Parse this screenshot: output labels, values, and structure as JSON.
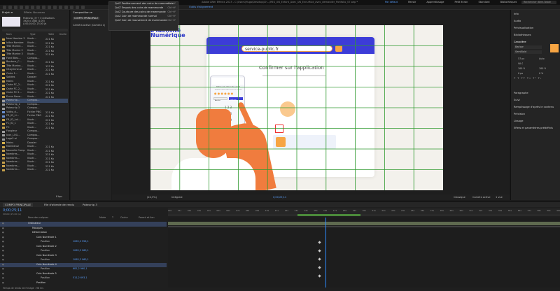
{
  "app": {
    "title": "Adobe After Effects 2023 - C:\\Users\\Hugo\\Desktop\\Ch...\\RES_UN_Enfant_Avec_UN_Ennuffuid_avec_demander_Portfolio_07.aep *",
    "workspaces": [
      "Par défaut",
      "Revoir",
      "Apprentissage",
      "Petit écran",
      "Standard",
      "Bibliothèques"
    ],
    "search_placeholder": "Rechercher: Bem-Totale"
  },
  "colors": {
    "accent_blue": "#2d8cff",
    "highlight_orange": "#f7a543",
    "grid_green": "#2f9a2f",
    "canvas_bg": "#f3f1ec",
    "ui_bg": "#1b1b1b"
  },
  "project_panel": {
    "tab": "Projet ≡",
    "tab2": "Effets: Nouveau",
    "preview_info": [
      "Pokeunip_3++  0 utilisations",
      "1920 x 1080  (1,00)",
      "Δ 00;10;00, 25,00 i/s"
    ],
    "columns": [
      "Nom",
      "Type",
      "Taille",
      "Durée"
    ],
    "items": [
      {
        "name": "Nom Nombre 3",
        "type": "Illustr...",
        "size": "221 Ko",
        "color": "#c6a04b"
      },
      {
        "name": "Icône Nombre",
        "type": "Illustr...",
        "size": "221 Ko",
        "color": "#c6a04b"
      },
      {
        "name": "Tête Marine...",
        "type": "Illustr...",
        "size": "221 Ko",
        "color": "#c6a04b"
      },
      {
        "name": "Tête Marine 2",
        "type": "Illustr...",
        "size": "221 Ko",
        "color": "#c6a04b"
      },
      {
        "name": "Tête Marine 3",
        "type": "Illustr...",
        "size": "221 Ko",
        "color": "#c6a04b"
      },
      {
        "name": "Fond Bleu...",
        "type": "Compos...",
        "size": "",
        "color": "#9c9c9c"
      },
      {
        "name": "Boutons_C...",
        "type": "Illustr...",
        "size": "221 Ko",
        "color": "#c6a04b"
      },
      {
        "name": "Tête Marine...",
        "type": "Illustr...",
        "size": "137 Ko",
        "color": "#c6a04b"
      },
      {
        "name": "Citoyenne.ai",
        "type": "Illustr...",
        "size": "221 Ko",
        "color": "#c6a04b"
      },
      {
        "name": "Carte 1...",
        "type": "Illustr...",
        "size": "221 Ko",
        "color": "#c6a04b"
      },
      {
        "name": "Solides",
        "type": "Dossier",
        "size": "",
        "color": "#d4b04a"
      },
      {
        "name": "Mains",
        "type": "Illustr...",
        "size": "221 Ko",
        "color": "#c6a04b"
      },
      {
        "name": "Carte FC_2...",
        "type": "Illustr...",
        "size": "221 Ko",
        "color": "#c6a04b"
      },
      {
        "name": "Carte FC_2...",
        "type": "Illustr...",
        "size": "221 Ko",
        "color": "#c6a04b"
      },
      {
        "name": "Carte FC 2...",
        "type": "Illustr...",
        "size": "221 Ko",
        "color": "#c6a04b"
      },
      {
        "name": "Ecran Nave...",
        "type": "Illustr...",
        "size": "221 Ko",
        "color": "#c6a04b"
      },
      {
        "name": "Pokeunip...",
        "type": "Compos...",
        "size": "",
        "color": "#9c9c9c"
      },
      {
        "name": "Pokeunip_2",
        "type": "Compos...",
        "size": "",
        "color": "#9c9c9c"
      },
      {
        "name": "Pokeunip 3",
        "type": "Compos...",
        "size": "",
        "color": "#9c9c9c"
      },
      {
        "name": "Vidéo_d...",
        "type": "Fichier PNG",
        "size": "221 Ko",
        "color": "#6a8fd0"
      },
      {
        "name": "FR_ID_Li...",
        "type": "Fichier PNG",
        "size": "221 Ko",
        "color": "#6a8fd0"
      },
      {
        "name": "FR_ID_LoL...",
        "type": "Illustr...",
        "size": "221 Ko",
        "color": "#c6a04b"
      },
      {
        "name": "FC_ID_1",
        "type": "Illustr...",
        "size": "221 Ko",
        "color": "#c6a04b"
      },
      {
        "name": "FC",
        "type": "Illustr...",
        "size": "221 Ko",
        "color": "#c6a04b"
      },
      {
        "name": "Fongleur",
        "type": "Compos...",
        "size": "",
        "color": "#9c9c9c"
      },
      {
        "name": "Icon_LOG...",
        "type": "Compos...",
        "size": "",
        "color": "#9c9c9c"
      },
      {
        "name": "Logo2.ai",
        "type": "Compos...",
        "size": "",
        "color": "#9c9c9c"
      },
      {
        "name": "Mains",
        "type": "Dossier",
        "size": "",
        "color": "#d4b04a"
      },
      {
        "name": "Mainbleu2",
        "type": "Illustr...",
        "size": "221 Ko",
        "color": "#c6a04b"
      },
      {
        "name": "Nouvelle Comp",
        "type": "Illustr...",
        "size": "221 Ko",
        "color": "#c6a04b"
      },
      {
        "name": "Nombres...",
        "type": "Illustr...",
        "size": "221 Ko",
        "color": "#c6a04b"
      },
      {
        "name": "Nombres...",
        "type": "Illustr...",
        "size": "221 Ko",
        "color": "#c6a04b"
      },
      {
        "name": "Nombres...",
        "type": "Illustr...",
        "size": "221 Ko",
        "color": "#c6a04b"
      },
      {
        "name": "Nombres...",
        "type": "Illustr...",
        "size": "221 Ko",
        "color": "#c6a04b"
      },
      {
        "name": "Nombres...",
        "type": "Illustr...",
        "size": "221 Ko",
        "color": "#c6a04b"
      }
    ],
    "footer": "8 bpc"
  },
  "effects_panel": {
    "tab": "Composition ≡",
    "comp_name": "COMPO PRINCIPALE",
    "camera": "Caméra active (Caméra 1)"
  },
  "viewer_menu": {
    "items": [
      {
        "label": "QuiZ Positionnement des coins de mammonde",
        "shortcut": "Ctrl+Y"
      },
      {
        "label": "QuiZ Empois des coins de mammonde",
        "shortcut": "Ctrl+Y"
      },
      {
        "label": "QuiZ Courbure des coins de mammonde",
        "shortcut": "Ctrl+Y"
      },
      {
        "label": "QuiZ Coin de mammonde normal",
        "shortcut": "Ctrl+Y"
      },
      {
        "label": "QuiZ Coin de mouvement de mammonde",
        "shortcut": "Ctrl+Y"
      }
    ],
    "snap_label": "Outils d'alignement"
  },
  "canvas": {
    "logo_line1": "L'Identité",
    "logo_line2": "Numérique",
    "url": "service-public.fr",
    "heading": "Confirmer sur l'application",
    "phone_heading": "Retrouvez votre code secret",
    "phone_text": "Saisissez votre code secret à 6 chiffres",
    "phone_btn1": "Annuler",
    "phone_btn2": "Confirmer"
  },
  "viewer_footer": {
    "zoom": "(24,3%)",
    "quality": "Intégrale",
    "timecode": "0;00;25;11",
    "renderer": "Classique",
    "camera": "Caméra active",
    "views": "1 vue"
  },
  "right_panel": {
    "sections": [
      "Info",
      "Audio",
      "Prévisualisation",
      "Bibliothèques",
      "Caractère",
      "Paragraphe",
      "Suivi",
      "Remplissage d'après le contenu",
      "Précision",
      "Lissage",
      "Effets et paramètres prédéfinis"
    ],
    "font_name": "Barlow",
    "font_style": "SemiBold",
    "font_size": "57 px",
    "leading": "Auto",
    "tracking": "VA 0",
    "percent_a": "100 %",
    "percent_b": "100 %",
    "baseline": "0 px",
    "tsume": "0 %"
  },
  "timeline": {
    "tabs": [
      "COMPO PRINCIPALE",
      "File d'attente de rendu",
      "Pokeunip 3"
    ],
    "timecode": "0;00;25;11",
    "frame": "00640 (25.00 i/s)",
    "columns": [
      "Nom des calques",
      "Mode",
      "T",
      "Cache",
      "Parent et lien"
    ],
    "layers": [
      {
        "name": "Ordinateur",
        "indent": 0,
        "value": "",
        "selected": true
      },
      {
        "name": "Masques",
        "indent": 1,
        "value": "",
        "selected": false
      },
      {
        "name": "Déformation",
        "indent": 1,
        "value": "",
        "selected": false
      },
      {
        "name": "Coin Numérote 1",
        "indent": 2,
        "value": "",
        "selected": false
      },
      {
        "name": "Position",
        "indent": 3,
        "value": "1065,2 956,1",
        "selected": false
      },
      {
        "name": "Coin Numérote 2",
        "indent": 2,
        "value": "",
        "selected": false
      },
      {
        "name": "Position",
        "indent": 3,
        "value": "1065,2 960,1",
        "selected": false
      },
      {
        "name": "Coin Numérote 3",
        "indent": 2,
        "value": "",
        "selected": false
      },
      {
        "name": "Position",
        "indent": 3,
        "value": "1065,2 960,1",
        "selected": false
      },
      {
        "name": "Coin Numérote 4",
        "indent": 2,
        "value": "",
        "selected": true
      },
      {
        "name": "Position",
        "indent": 3,
        "value": "681,2 960,1",
        "selected": false
      },
      {
        "name": "Coin Numérote 5",
        "indent": 2,
        "value": "",
        "selected": false
      },
      {
        "name": "Position",
        "indent": 3,
        "value": "511,2 693,1",
        "selected": false
      },
      {
        "name": "Position",
        "indent": 2,
        "value": "",
        "selected": false
      }
    ],
    "ruler_labels": [
      "00s",
      "01s",
      "02s",
      "03s",
      "04s",
      "05s",
      "06s",
      "07s",
      "08s",
      "09s",
      "10s",
      "11s",
      "12s",
      "13s",
      "14s",
      "15s",
      "16s",
      "17s",
      "18s",
      "19s",
      "20s",
      "21s",
      "22s",
      "23s",
      "24s",
      "25s",
      "26s",
      "27s",
      "28s",
      "29s",
      "30s",
      "31s",
      "32s",
      "33s",
      "34s",
      "35s",
      "36s",
      "37s",
      "38s",
      "39s",
      "40s"
    ],
    "footer_text": "Temps de rendu de l'image : 98 ms",
    "mode_label": "Normal",
    "parent_label": "Aucun(e)"
  }
}
